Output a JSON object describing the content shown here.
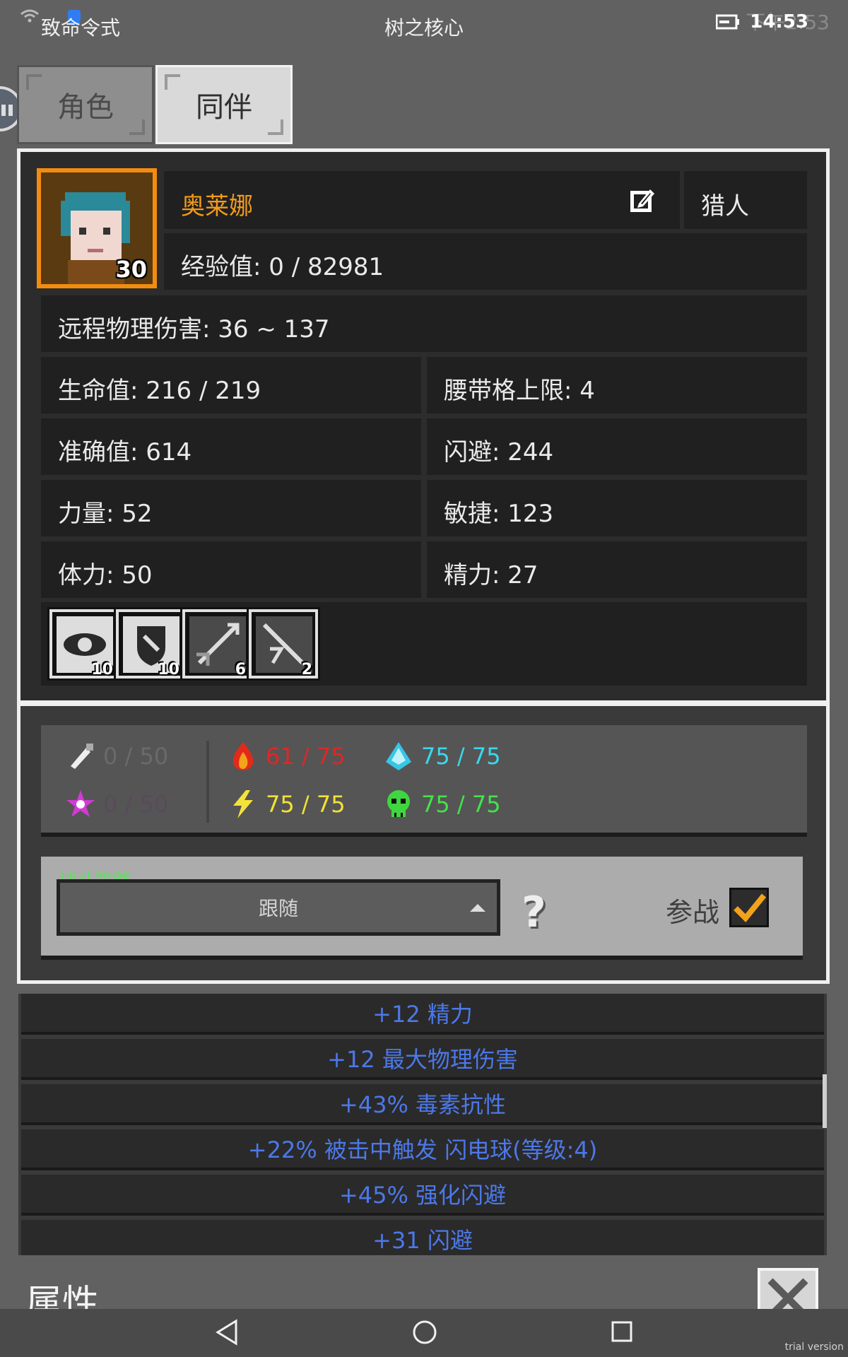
{
  "status": {
    "left_text": "致命令式",
    "title": "树之核心",
    "time": "14:53",
    "ghost_time": "下午2:53"
  },
  "tabs": [
    {
      "label": "角色"
    },
    {
      "label": "同伴"
    }
  ],
  "companion": {
    "level": "30",
    "name": "奥莱娜",
    "class": "猎人",
    "xp": "经验值: 0 / 82981",
    "damage": "远程物理伤害: 36 ~ 137",
    "stats": [
      [
        "生命值: 216 / 219",
        "腰带格上限: 4"
      ],
      [
        "准确值: 614",
        "闪避: 244"
      ],
      [
        "力量: 52",
        "敏捷: 123"
      ],
      [
        "体力: 50",
        "精力: 27"
      ]
    ],
    "skills": [
      {
        "icon": "eye-skill-icon",
        "count": "10"
      },
      {
        "icon": "shield-skill-icon",
        "count": "10"
      },
      {
        "icon": "arrow-skill-icon",
        "count": "6"
      },
      {
        "icon": "sword-skill-icon",
        "count": "2"
      }
    ]
  },
  "resistances": {
    "physical": {
      "value": "0 / 50",
      "color": "#6a6a6a"
    },
    "magic": {
      "value": "0 / 50",
      "color": "#5a4a5a"
    },
    "fire": {
      "value": "61 / 75",
      "color": "#e02626"
    },
    "lightning": {
      "value": "75 / 75",
      "color": "#f2e235"
    },
    "cold": {
      "value": "75 / 75",
      "color": "#3ad7ec"
    },
    "poison": {
      "value": "75 / 75",
      "color": "#44e24a"
    }
  },
  "strategy": {
    "label": "战斗策略",
    "selected": "跟随",
    "join_label": "参战"
  },
  "affixes": [
    "+12 精力",
    "+12 最大物理伤害",
    "+43% 毒素抗性",
    "+22% 被击中触发 闪电球(等级:4)",
    "+45% 强化闪避",
    "+31 闪避"
  ],
  "footer": {
    "label": "属性",
    "trial": "trial version"
  }
}
